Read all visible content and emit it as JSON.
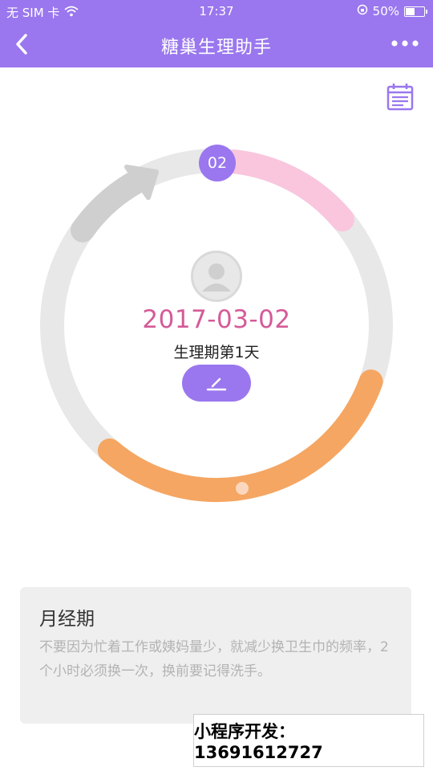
{
  "status_bar": {
    "carrier": "无 SIM 卡",
    "time": "17:37",
    "battery_percent": "50%",
    "battery_level": 0.5
  },
  "nav": {
    "title": "糖巢生理助手",
    "back_icon": "chevron-left-icon",
    "more_icon": "more-dots-icon"
  },
  "calendar_icon": "calendar-icon",
  "cycle": {
    "day_badge": "02",
    "date": "2017-03-02",
    "status": "生理期第1天",
    "edit_icon": "edit-pencil-icon"
  },
  "colors": {
    "primary": "#9a77ee",
    "date": "#d45b98",
    "pink_segment": "#f9c6de",
    "orange_segment": "#f5a662",
    "track": "#e8e8e8",
    "arrow": "#cfcfcf"
  },
  "tip": {
    "title": "月经期",
    "body": "不要因为忙着工作或姨妈量少，就减少换卫生巾的频率，2个小时必须换一次，换前要记得洗手。"
  },
  "promo": {
    "text": "小程序开发：13691612727"
  }
}
